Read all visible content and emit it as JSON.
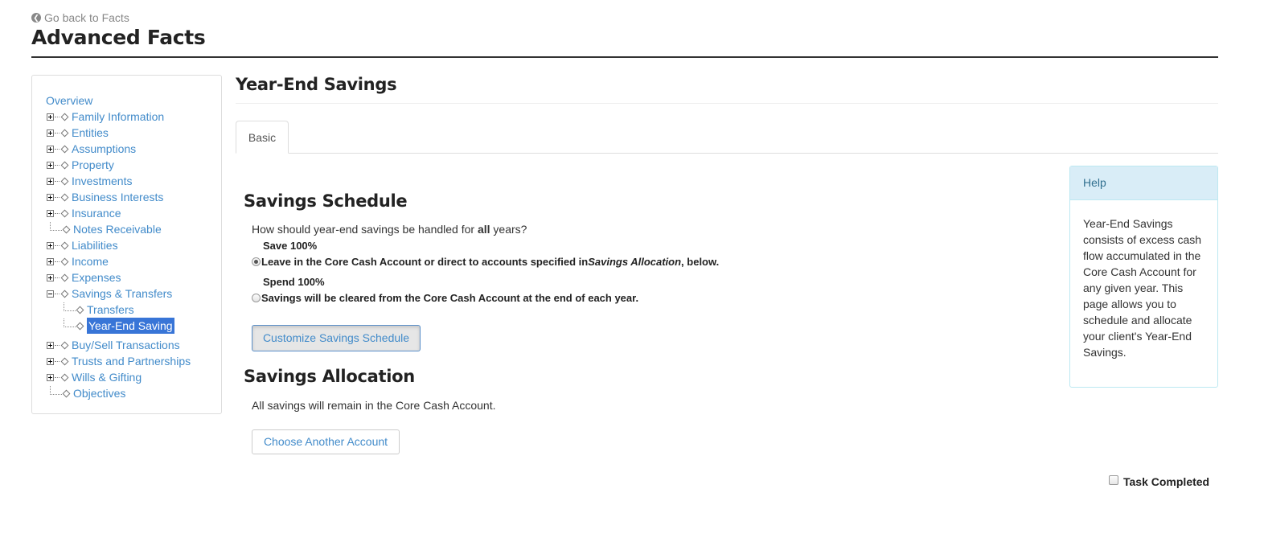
{
  "header": {
    "back_link": "Go back to Facts",
    "title": "Advanced Facts"
  },
  "sidebar": {
    "overview": "Overview",
    "items": [
      {
        "label": "Family Information",
        "expander": "plus"
      },
      {
        "label": "Entities",
        "expander": "plus"
      },
      {
        "label": "Assumptions",
        "expander": "plus"
      },
      {
        "label": "Property",
        "expander": "plus"
      },
      {
        "label": "Investments",
        "expander": "plus"
      },
      {
        "label": "Business Interests",
        "expander": "plus"
      },
      {
        "label": "Insurance",
        "expander": "plus"
      },
      {
        "label": "Notes Receivable",
        "expander": "none"
      },
      {
        "label": "Liabilities",
        "expander": "plus"
      },
      {
        "label": "Income",
        "expander": "plus"
      },
      {
        "label": "Expenses",
        "expander": "plus"
      },
      {
        "label": "Savings & Transfers",
        "expander": "minus"
      },
      {
        "label": "Transfers",
        "child": true
      },
      {
        "label": "Year-End Saving",
        "child": true,
        "selected": true
      },
      {
        "label": "Buy/Sell Transactions",
        "expander": "plus"
      },
      {
        "label": "Trusts and Partnerships",
        "expander": "plus"
      },
      {
        "label": "Wills & Gifting",
        "expander": "plus"
      },
      {
        "label": "Objectives",
        "expander": "none"
      }
    ]
  },
  "main": {
    "title": "Year-End Savings",
    "tabs": [
      {
        "label": "Basic",
        "active": true
      }
    ],
    "schedule": {
      "heading": "Savings Schedule",
      "question_pre": "How should year-end savings be handled for ",
      "question_bold": "all",
      "question_post": " years?",
      "options": [
        {
          "title": "Save 100%",
          "text_pre": "Leave in the Core Cash Account or direct to accounts specified in ",
          "text_em": "Savings Allocation",
          "text_post": ", below.",
          "selected": true
        },
        {
          "title": "Spend 100%",
          "text": "Savings will be cleared from the Core Cash Account at the end of each year.",
          "selected": false
        }
      ],
      "customize_button": "Customize Savings Schedule"
    },
    "allocation": {
      "heading": "Savings Allocation",
      "text": "All savings will remain in the Core Cash Account.",
      "choose_button": "Choose Another Account"
    },
    "task_completed": {
      "label": "Task Completed",
      "checked": false
    }
  },
  "help": {
    "title": "Help",
    "lines": [
      "Year-End Savings",
      "consists of excess cash",
      "flow accumulated in the",
      "Core Cash Account for",
      "any given year. This",
      "page allows you to",
      "schedule and allocate",
      "your client's Year-End",
      "Savings."
    ]
  }
}
